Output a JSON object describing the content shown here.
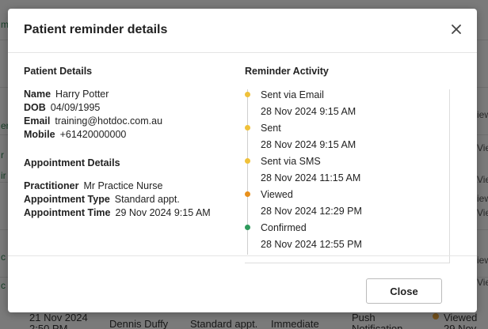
{
  "modal": {
    "title": "Patient reminder details",
    "close_label": "Close"
  },
  "patient": {
    "section_title": "Patient Details",
    "fields": [
      {
        "label": "Name",
        "value": "Harry Potter"
      },
      {
        "label": "DOB",
        "value": "04/09/1995"
      },
      {
        "label": "Email",
        "value": "training@hotdoc.com.au"
      },
      {
        "label": "Mobile",
        "value": "+61420000000"
      }
    ]
  },
  "appointment": {
    "section_title": "Appointment Details",
    "fields": [
      {
        "label": "Practitioner",
        "value": "Mr Practice Nurse"
      },
      {
        "label": "Appointment Type",
        "value": "Standard appt."
      },
      {
        "label": "Appointment Time",
        "value": "29 Nov 2024 9:15 AM"
      }
    ]
  },
  "activity": {
    "section_title": "Reminder Activity",
    "items": [
      {
        "label": "Sent via Email",
        "time": "28 Nov 2024 9:15 AM",
        "color": "#f0c13a"
      },
      {
        "label": "Sent",
        "time": "28 Nov 2024 9:15 AM",
        "color": "#f0c13a"
      },
      {
        "label": "Sent via SMS",
        "time": "28 Nov 2024 11:15 AM",
        "color": "#f0c13a"
      },
      {
        "label": "Viewed",
        "time": "28 Nov 2024 12:29 PM",
        "color": "#e8901c"
      },
      {
        "label": "Confirmed",
        "time": "28 Nov 2024 12:55 PM",
        "color": "#2e9a5c"
      }
    ]
  },
  "background": {
    "left_fragments": [
      "m",
      "er",
      "r",
      "ir",
      "c",
      "c"
    ],
    "right_fragments": [
      "iewed",
      "Vie",
      "Vie",
      "Vie",
      "iewed",
      "iewed",
      "Vie"
    ],
    "bottom_row": {
      "date": "21 Nov 2024",
      "time": "2:50 PM",
      "practitioner": "Dennis Duffy",
      "type": "Standard appt.",
      "timing": "Immediate",
      "channel_1": "Push",
      "channel_2": "Notification",
      "status": "Viewed",
      "status_time": "29 Nov"
    }
  }
}
